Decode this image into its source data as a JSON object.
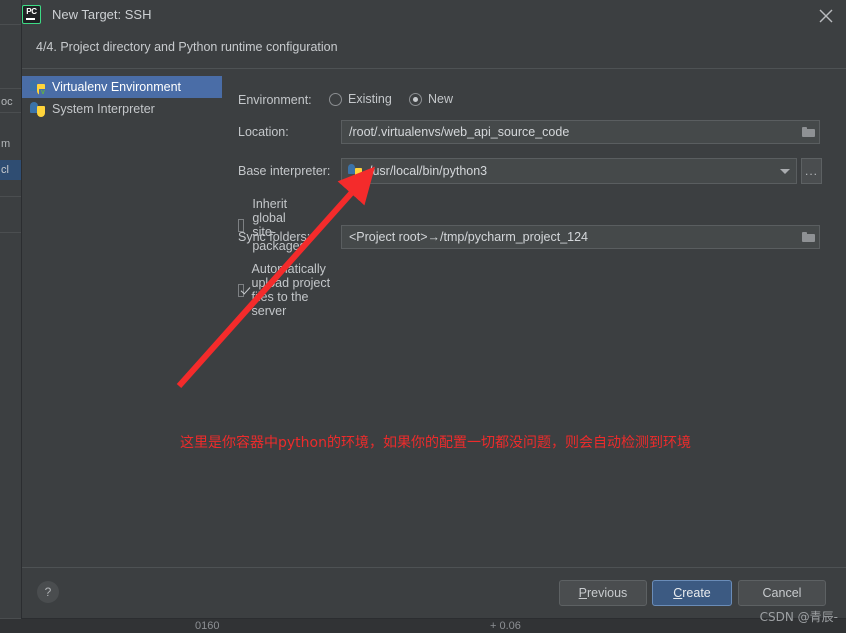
{
  "window": {
    "app_icon": "pycharm-logo-icon",
    "app_icon_text": "PC",
    "title": "New Target: SSH",
    "close_icon": "close-icon",
    "subtitle": "4/4. Project directory and Python runtime configuration"
  },
  "env_list": {
    "items": [
      {
        "label": "Virtualenv Environment",
        "icon": "python-virtualenv-icon",
        "badge": "v",
        "selected": true
      },
      {
        "label": "System Interpreter",
        "icon": "python-icon",
        "badge": "",
        "selected": false
      }
    ]
  },
  "form": {
    "environment": {
      "label": "Environment:",
      "options": [
        {
          "label": "Existing",
          "selected": false
        },
        {
          "label": "New",
          "selected": true
        }
      ]
    },
    "location": {
      "label": "Location:",
      "value": "/root/.virtualenvs/web_api_source_code",
      "browse_icon": "folder-icon"
    },
    "base_interpreter": {
      "label": "Base interpreter:",
      "value": "/usr/local/bin/python3",
      "value_icon": "python-icon",
      "dropdown_icon": "chevron-down-icon",
      "more_button_label": "..."
    },
    "inherit_site_packages": {
      "label": "Inherit global site-packages",
      "checked": false
    },
    "sync_folders": {
      "label": "Sync folders:",
      "value": "<Project root>→/tmp/pycharm_project_124",
      "browse_icon": "folder-icon"
    },
    "auto_upload": {
      "label": "Automatically upload project files to the server",
      "checked": true
    }
  },
  "annotation": {
    "text": "这里是你容器中python的环境，如果你的配置一切都没问题，则会自动检测到环境",
    "color": "#ed2b2b",
    "arrow": "red-arrow-pointing-to-base-interpreter"
  },
  "footer": {
    "help_label": "?",
    "buttons": [
      {
        "label": "Previous",
        "mnemonic": "P",
        "primary": false
      },
      {
        "label": "Create",
        "mnemonic": "C",
        "primary": true
      },
      {
        "label": "Cancel",
        "mnemonic": "",
        "primary": false
      }
    ]
  },
  "watermark": {
    "text": "CSDN @青辰-"
  },
  "background": {
    "rows": [
      "oc",
      "m",
      "cl"
    ],
    "bottom_left": "0160",
    "bottom_right": "+ 0.06"
  },
  "colors": {
    "dialog_bg": "#3c3f41",
    "selection_blue": "#4a6da7",
    "primary_button": "#3c5a82",
    "annotation_red": "#ed2b2b",
    "field_bg": "#45494a"
  }
}
